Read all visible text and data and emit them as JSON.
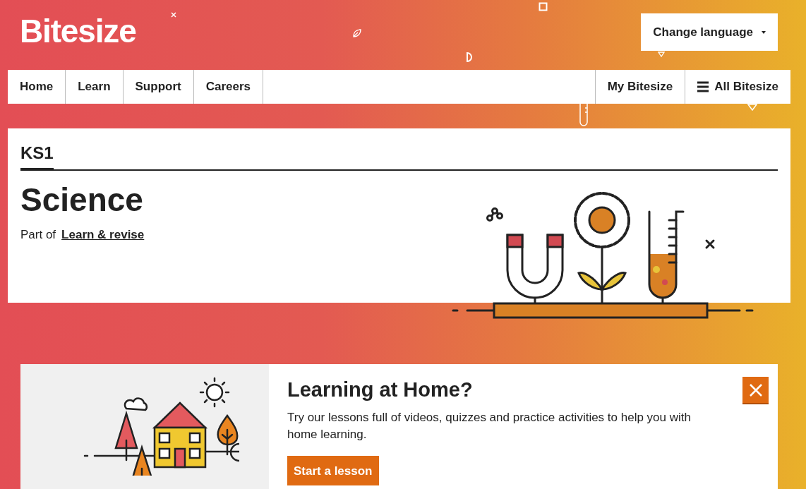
{
  "logo": "Bitesize",
  "language_button": {
    "label": "Change language"
  },
  "nav": {
    "left": [
      {
        "label": "Home"
      },
      {
        "label": "Learn"
      },
      {
        "label": "Support"
      },
      {
        "label": "Careers"
      }
    ],
    "right": [
      {
        "label": "My Bitesize",
        "kind": "plain"
      },
      {
        "label": "All Bitesize",
        "kind": "menu"
      }
    ]
  },
  "header_card": {
    "level_tab": "KS1",
    "title": "Science",
    "part_of": "Part of",
    "link": "Learn & revise"
  },
  "promo": {
    "title": "Learning at Home?",
    "text": "Try our lessons full of videos, quizzes and practice activities to help you with home learning.",
    "button": "Start a lesson"
  }
}
